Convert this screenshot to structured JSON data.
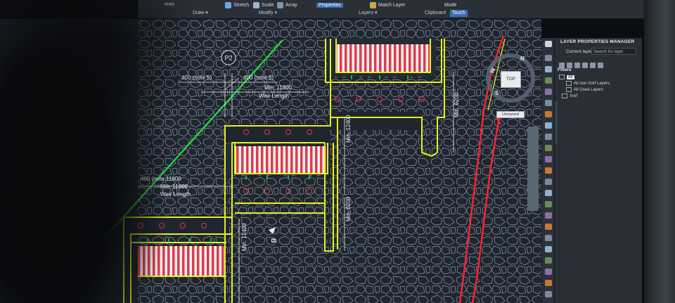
{
  "ribbon": {
    "buttons": {
      "stretch": "Stretch",
      "scale": "Scale",
      "array": "Array",
      "properties": "Properties",
      "match_layer": "Match Layer",
      "mode": "Mode",
      "touch": "Touch"
    },
    "partial_label": "iews",
    "panels": {
      "draw": "Draw",
      "modify": "Modify",
      "layers": "Layers",
      "clipboard": "Clipboard"
    }
  },
  "drawing": {
    "grid_bubble": "P2",
    "dims": {
      "note5_a": "400 (note 5)",
      "note5_b": "400 (note 5)",
      "note_11800_top": "400 (note 11800",
      "min_11800_top": "Min. 11800",
      "weir_length_top": "Weir Length",
      "min_11800_left": "Min. 11800",
      "weir_length_left": "Weir Length",
      "min_12400_a": "Min. 12400",
      "min_12400_b": "Min. 12400",
      "min_6200_a": "Min. 6200",
      "min_6200_b": "Min. 6200",
      "section_marker": "B"
    }
  },
  "viewcube": {
    "top": "TOP",
    "north": "N",
    "west": "W",
    "south": "S",
    "unnamed": "Unnamed"
  },
  "layer_panel": {
    "title": "LAYER PROPERTIES MANAGER",
    "current_layer": "Current layer",
    "search_placeholder": "Search for layer",
    "filters_label": "Filters",
    "tree": {
      "all": "All",
      "non_xref": "All non-Xref Layers",
      "used": "All Used Layers",
      "xref": "Xref"
    }
  },
  "colors": {
    "canvas_bg": "#1f2630",
    "pattern": "#8d97a8",
    "outline_yellow": "#e4ef1c",
    "hatch_red": "#e03a4a",
    "boundary_red": "#ff2233",
    "line_green": "#22e03a",
    "dim_white": "#e9ecef"
  }
}
